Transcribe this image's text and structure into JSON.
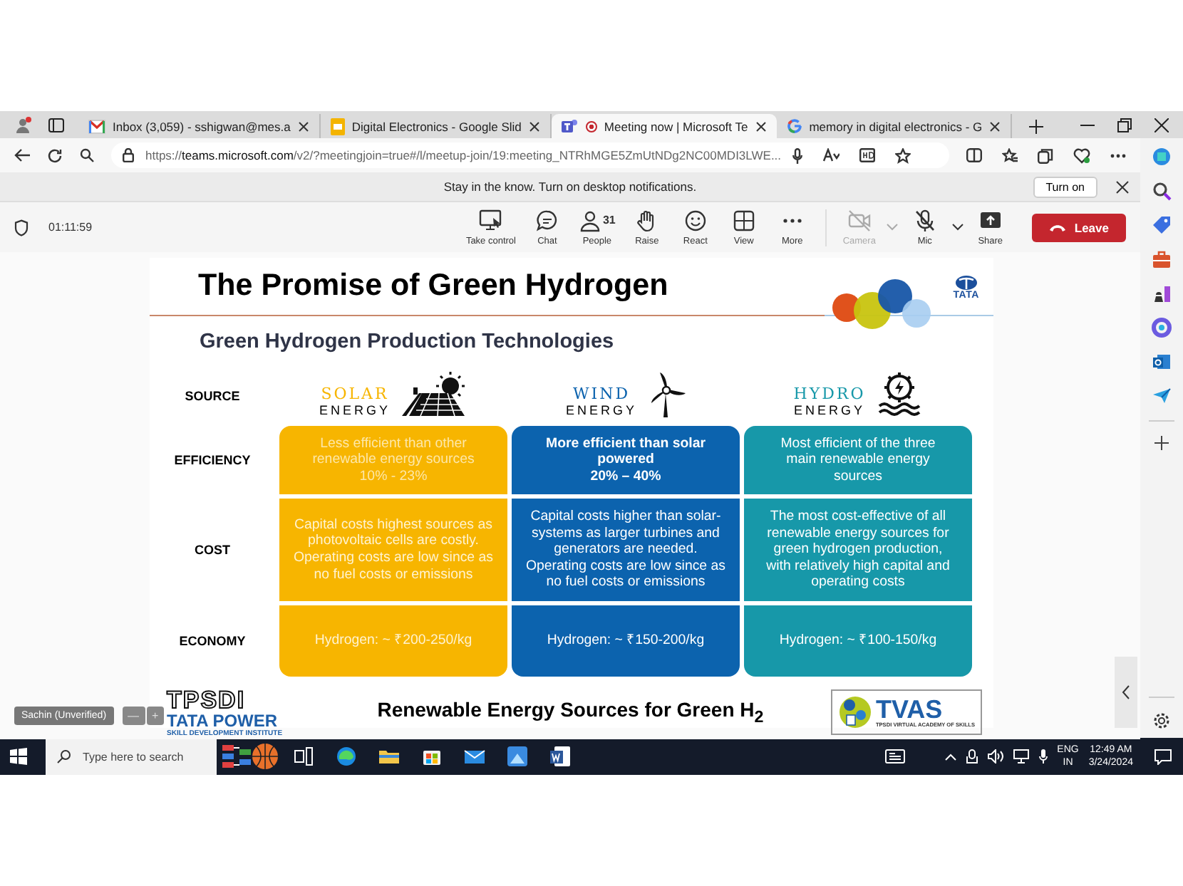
{
  "browser": {
    "tabs": [
      {
        "kind": "mail",
        "label": "Inbox (3,059) - sshigwan@mes.a",
        "selected": false,
        "recording": false
      },
      {
        "kind": "slides",
        "label": "Digital Electronics - Google Slid",
        "selected": false,
        "recording": false
      },
      {
        "kind": "teams",
        "label": "Meeting now | Microsoft Te",
        "selected": true,
        "recording": true
      },
      {
        "kind": "google",
        "label": "memory in digital electronics - G",
        "selected": false,
        "recording": false
      }
    ],
    "address": "https://**teams.microsoft.com**/v2/?meetingjoin=true#/l/meetup-join/19:meeting_NTRhMGE5ZmUtNDg2NC00MDI3LWE..."
  },
  "notification": {
    "text": "Stay in the know. Turn on desktop notifications.",
    "button": "Turn on"
  },
  "meeting": {
    "timer": "01:11:59",
    "tools": [
      {
        "kind": "take-control",
        "label": "Take control",
        "disabled": false
      },
      {
        "kind": "chat",
        "label": "Chat",
        "disabled": false
      },
      {
        "kind": "people",
        "label": "People",
        "count": "31",
        "disabled": false
      },
      {
        "kind": "raise",
        "label": "Raise",
        "disabled": false
      },
      {
        "kind": "react",
        "label": "React",
        "disabled": false
      },
      {
        "kind": "view",
        "label": "View",
        "disabled": false
      },
      {
        "kind": "more",
        "label": "More",
        "disabled": false
      },
      {
        "kind": "camera",
        "label": "Camera",
        "disabled": true
      },
      {
        "kind": "mic",
        "label": "Mic",
        "disabled": false
      },
      {
        "kind": "share",
        "label": "Share",
        "disabled": false
      }
    ],
    "leave": "Leave",
    "participant": "Sachin (Unverified)",
    "zoom_out": "—",
    "zoom_in": "+"
  },
  "slide": {
    "title": "The Promise of Green Hydrogen",
    "brand": "TATA",
    "subtitle": "Green Hydrogen Production Technologies",
    "source_label": "SOURCE",
    "columns": [
      {
        "kind": "solar",
        "name": "SOLAR",
        "sub": "ENERGY",
        "color": "#f7b500"
      },
      {
        "kind": "wind",
        "name": "WIND",
        "sub": "ENERGY",
        "color": "#0c63ae"
      },
      {
        "kind": "hydro",
        "name": "HYDRO",
        "sub": "ENERGY",
        "color": "#1798a9"
      }
    ],
    "rows": [
      {
        "label": "EFFICIENCY",
        "cells": [
          {
            "text": "Less efficient than other\nrenewable energy sources\n10% - 23%",
            "bold": false
          },
          {
            "text": "More efficient than solar\npowered\n20% – 40%",
            "bold": true
          },
          {
            "text": "Most efficient of the three\nmain renewable energy\nsources",
            "bold": false
          }
        ]
      },
      {
        "label": "COST",
        "cells": [
          {
            "text": "Capital costs highest sources as\nphotovoltaic cells are costly.\nOperating costs are low since as\nno fuel costs or emissions",
            "bold": false
          },
          {
            "text": "Capital costs higher than solar-\nsystems as larger turbines and\ngenerators are needed.\nOperating costs are low since as\nno fuel costs or emissions",
            "bold": false
          },
          {
            "text": "The most cost-effective of all\nrenewable energy sources for\ngreen hydrogen production,\nwith relatively high capital and\noperating costs",
            "bold": false
          }
        ]
      },
      {
        "label": "ECONOMY",
        "cells": [
          {
            "text": "Hydrogen: ~ ₹200-250/kg",
            "bold": false
          },
          {
            "text": "Hydrogen: ~ ₹150-200/kg",
            "bold": false
          },
          {
            "text": "Hydrogen: ~ ₹100-150/kg",
            "bold": false
          }
        ]
      }
    ],
    "footer": "Renewable Energy Sources for Green H$_{2}$",
    "left_logo": {
      "mark": "TPSDI",
      "name": "TATA POWER",
      "tagline": "SKILL DEVELOPMENT INSTITUTE"
    },
    "right_logo": {
      "mark": "TVAS",
      "tagline": "TPSDI VIRTUAL ACADEMY OF SKILLS"
    }
  },
  "taskbar": {
    "search_placeholder": "Type here to search",
    "language": "ENG",
    "region": "IN",
    "time": "12:49 AM",
    "date": "3/24/2024"
  }
}
